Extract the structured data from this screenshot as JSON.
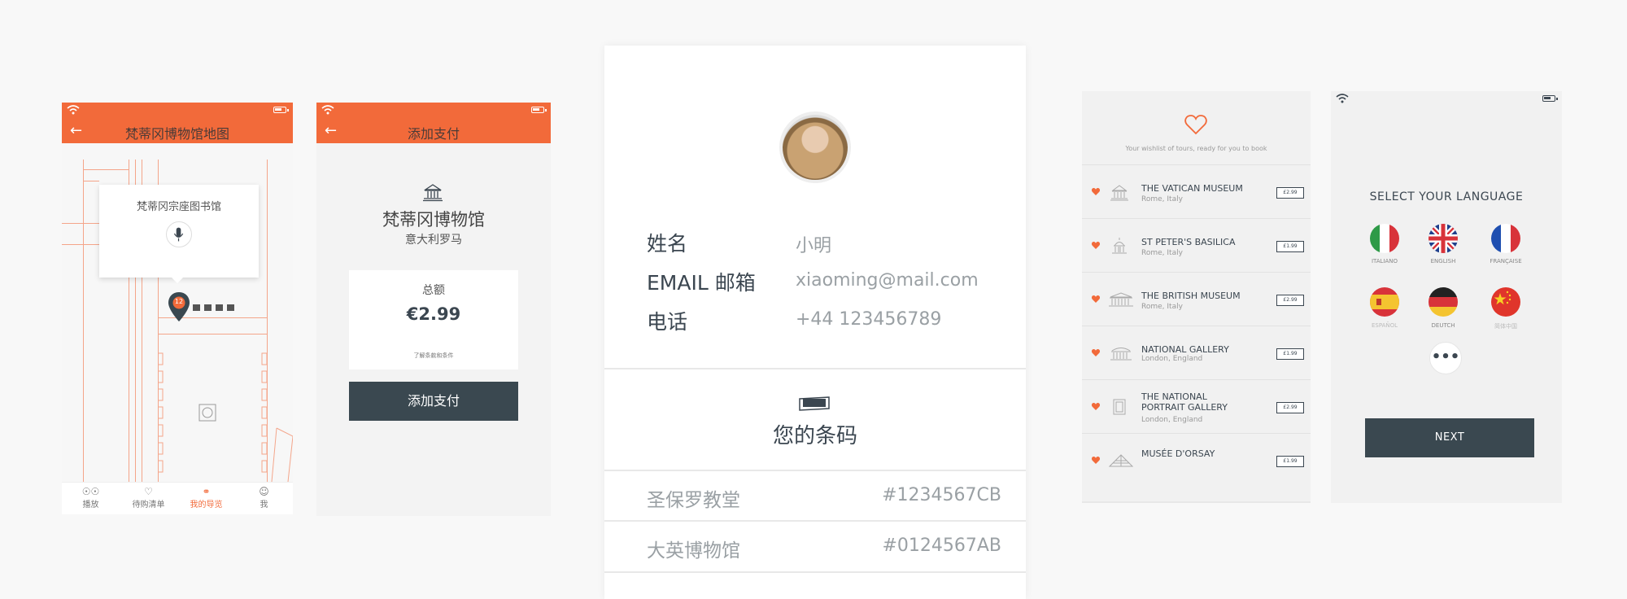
{
  "colors": {
    "accent": "#f26a3a",
    "dark": "#3a4850",
    "text": "#3b4650",
    "muted": "#9aa0a4"
  },
  "map_screen": {
    "header_title": "梵蒂冈博物馆地图",
    "popup_title": "梵蒂冈宗座图书馆",
    "pin_number": "12",
    "tabs": [
      {
        "label": "播放",
        "icon": "binoculars-icon"
      },
      {
        "label": "待购清单",
        "icon": "heart-icon"
      },
      {
        "label": "我的导览",
        "icon": "compass-icon"
      },
      {
        "label": "我",
        "icon": "user-icon"
      }
    ]
  },
  "payment_screen": {
    "header_title": "添加支付",
    "museum_name": "梵蒂冈博物馆",
    "location": "意大利罗马",
    "total_label": "总额",
    "amount": "€2.99",
    "terms": "了解条款和条件",
    "button_label": "添加支付"
  },
  "profile_screen": {
    "fields": [
      {
        "label": "姓名",
        "value": "小明"
      },
      {
        "label": "EMAIL 邮箱",
        "value": "xiaoming@mail.com"
      },
      {
        "label": "电话",
        "value": "+44 123456789"
      }
    ],
    "barcode_title": "您的条码",
    "barcodes": [
      {
        "name": "圣保罗教堂",
        "code": "#1234567CB"
      },
      {
        "name": "大英博物馆",
        "code": "#0124567AB"
      }
    ]
  },
  "wishlist_screen": {
    "subtitle": "Your wishlist of tours, ready for you to book",
    "items": [
      {
        "name": "THE VATICAN MUSEUM",
        "location": "Rome, Italy",
        "price": "£2.99"
      },
      {
        "name": "ST PETER'S BASILICA",
        "location": "Rome, Italy",
        "price": "£1.99"
      },
      {
        "name": "THE BRITISH MUSEUM",
        "location": "Rome, Italy",
        "price": "£2.99"
      },
      {
        "name": "NATIONAL GALLERY",
        "location": "London, England",
        "price": "£1.99"
      },
      {
        "name": "THE NATIONAL PORTRAIT GALLERY",
        "location": "London, England",
        "price": "£2.99"
      },
      {
        "name": "MUSÉE D'ORSAY",
        "location": "",
        "price": "£1.99"
      }
    ]
  },
  "language_screen": {
    "title": "SELECT YOUR LANGUAGE",
    "languages": [
      {
        "label": "ITALIANO"
      },
      {
        "label": "ENGLISH"
      },
      {
        "label": "FRANÇAISE"
      },
      {
        "label": "ESPAÑOL"
      },
      {
        "label": "DEUTCH"
      },
      {
        "label": "简体中国"
      }
    ],
    "more_label": "•••",
    "next_label": "NEXT"
  }
}
